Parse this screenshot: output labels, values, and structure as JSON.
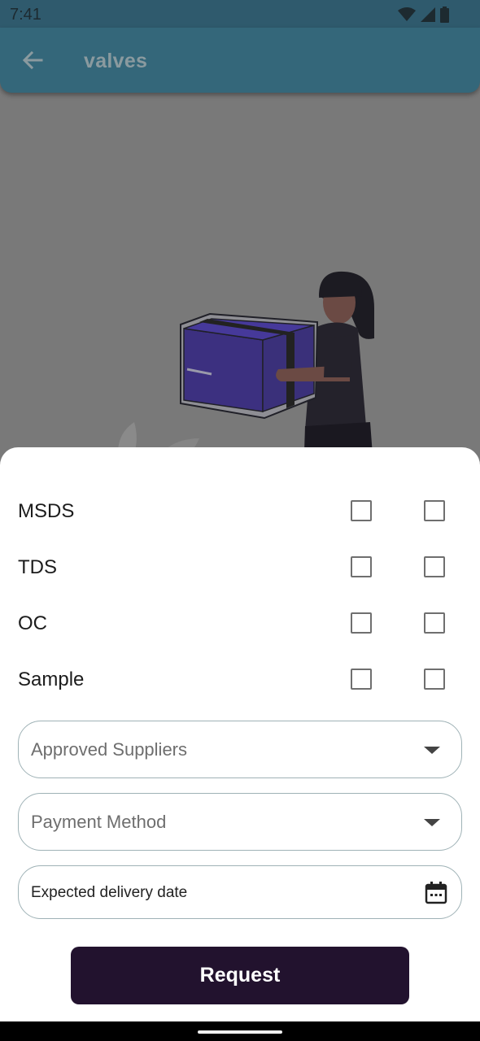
{
  "status_bar": {
    "time": "7:41"
  },
  "app_bar": {
    "title": "valves"
  },
  "documents": [
    {
      "label": "MSDS",
      "checked_1": false,
      "checked_2": false
    },
    {
      "label": "TDS",
      "checked_1": false,
      "checked_2": false
    },
    {
      "label": "OC",
      "checked_1": false,
      "checked_2": false
    },
    {
      "label": "Sample",
      "checked_1": false,
      "checked_2": false
    }
  ],
  "form": {
    "approved_suppliers_placeholder": "Approved Suppliers",
    "payment_method_placeholder": "Payment Method",
    "expected_delivery_placeholder": "Expected delivery date"
  },
  "actions": {
    "request_label": "Request"
  },
  "colors": {
    "app_bar": "#34677a",
    "button": "#22122e",
    "box_accent": "#3c3080"
  }
}
